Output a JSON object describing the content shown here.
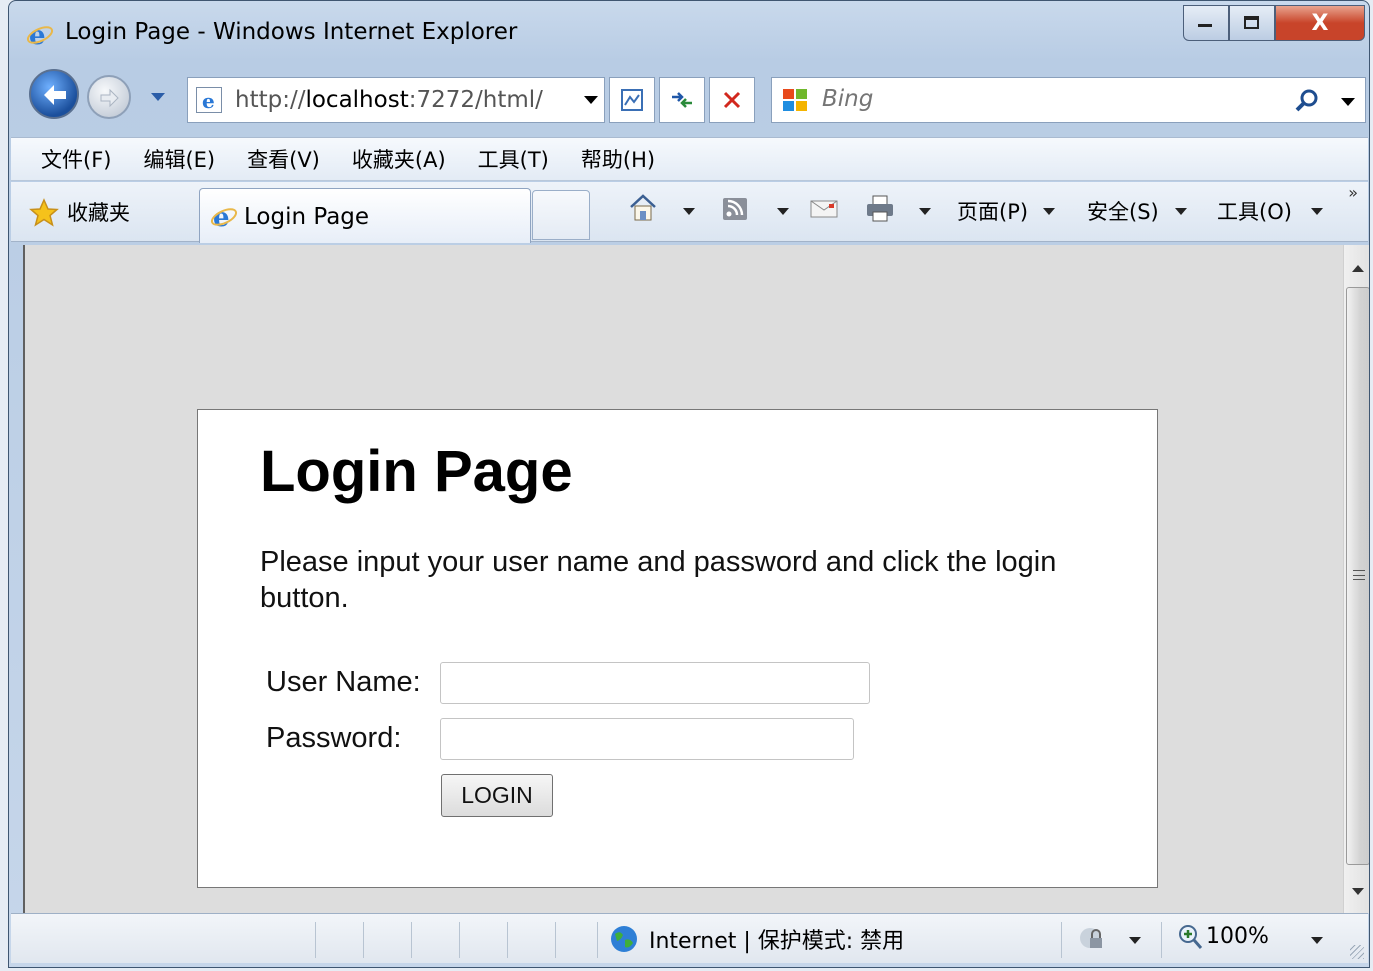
{
  "window": {
    "title": "Login Page - Windows Internet Explorer",
    "controls": {
      "minimize": "–",
      "maximize": "□",
      "close": "X"
    }
  },
  "address": {
    "prefix": "http://",
    "host": "localhost",
    "suffix": ":7272/html/"
  },
  "search": {
    "placeholder": "Bing"
  },
  "menubar": {
    "items": [
      "文件(F)",
      "编辑(E)",
      "查看(V)",
      "收藏夹(A)",
      "工具(T)",
      "帮助(H)"
    ]
  },
  "favorites": {
    "label": "收藏夹"
  },
  "tab": {
    "label": "Login Page"
  },
  "commandbar": {
    "page": "页面(P)",
    "safety": "安全(S)",
    "tools": "工具(O)",
    "more": "»"
  },
  "page": {
    "title": "Login Page",
    "description": "Please input your user name and password and click the login button.",
    "username_label": "User Name:",
    "password_label": "Password:",
    "username_value": "",
    "password_value": "",
    "login_button": "LOGIN"
  },
  "status": {
    "zone": "Internet | 保护模式: 禁用",
    "zoom": "100%"
  }
}
